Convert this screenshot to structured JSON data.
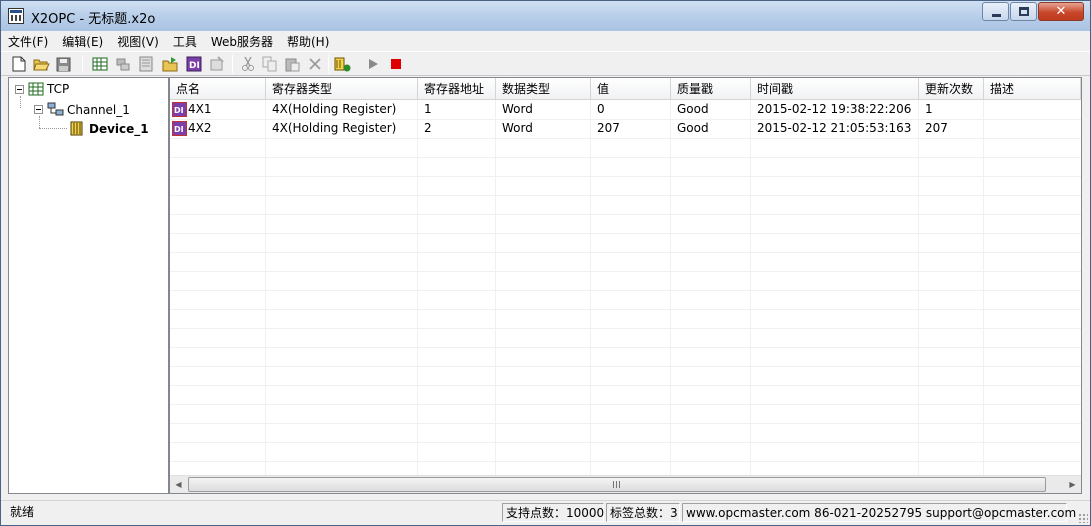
{
  "window": {
    "title": "X2OPC - 无标题.x2o"
  },
  "menu": [
    "文件(F)",
    "编辑(E)",
    "视图(V)",
    "工具",
    "Web服务器",
    "帮助(H)"
  ],
  "tree": {
    "root": "TCP",
    "channel": "Channel_1",
    "device": "Device_1"
  },
  "table": {
    "columns": [
      "点名",
      "寄存器类型",
      "寄存器地址",
      "数据类型",
      "值",
      "质量戳",
      "时间戳",
      "更新次数",
      "描述"
    ],
    "rows": [
      [
        "4X1",
        "4X(Holding Register)",
        "1",
        "Word",
        "0",
        "Good",
        "2015-02-12 19:38:22:206",
        "1",
        ""
      ],
      [
        "4X2",
        "4X(Holding Register)",
        "2",
        "Word",
        "207",
        "Good",
        "2015-02-12 21:05:53:163",
        "207",
        ""
      ]
    ]
  },
  "status": {
    "ready": "就绪",
    "support_points": "支持点数：10000",
    "tag_total": "标签总数：3",
    "contact": "www.opcmaster.com 86-021-20252795 support@opcmaster.com"
  },
  "colors": {
    "stop_red": "#e00000",
    "play_gray": "#8a8a8a",
    "title_gradient_top": "#cfe0f3",
    "close_red": "#c8482c"
  }
}
